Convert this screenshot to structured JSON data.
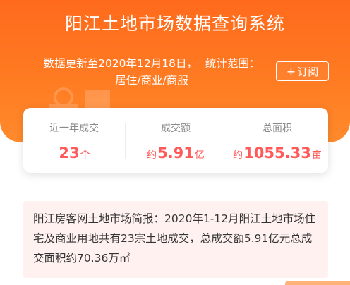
{
  "header": {
    "title": "阳江土地市场数据查询系统",
    "update_prefix": "数据更新至",
    "update_date": "2020年12月18日，",
    "scope_label": "统计范围：",
    "scope_value": "居住/商业/商服",
    "subscribe_label": "订阅",
    "subscribe_icon": "+"
  },
  "stats": [
    {
      "label": "近一年成交",
      "prefix": "",
      "value": "23",
      "unit": "个"
    },
    {
      "label": "成交额",
      "prefix": "约",
      "value": "5.91",
      "unit": "亿"
    },
    {
      "label": "总面积",
      "prefix": "约",
      "value": "1055.33",
      "unit": "亩"
    }
  ],
  "brief": {
    "text": "阳江房客网土地市场简报：2020年1-12月阳江土地市场住宅及商业用地共有23宗土地成交，总成交额5.91亿元总成交面积约70.36万㎡"
  },
  "colors": {
    "header_orange": "#ff7b22",
    "value_red": "#ff5a5a",
    "brief_bg": "#fff1f0"
  }
}
